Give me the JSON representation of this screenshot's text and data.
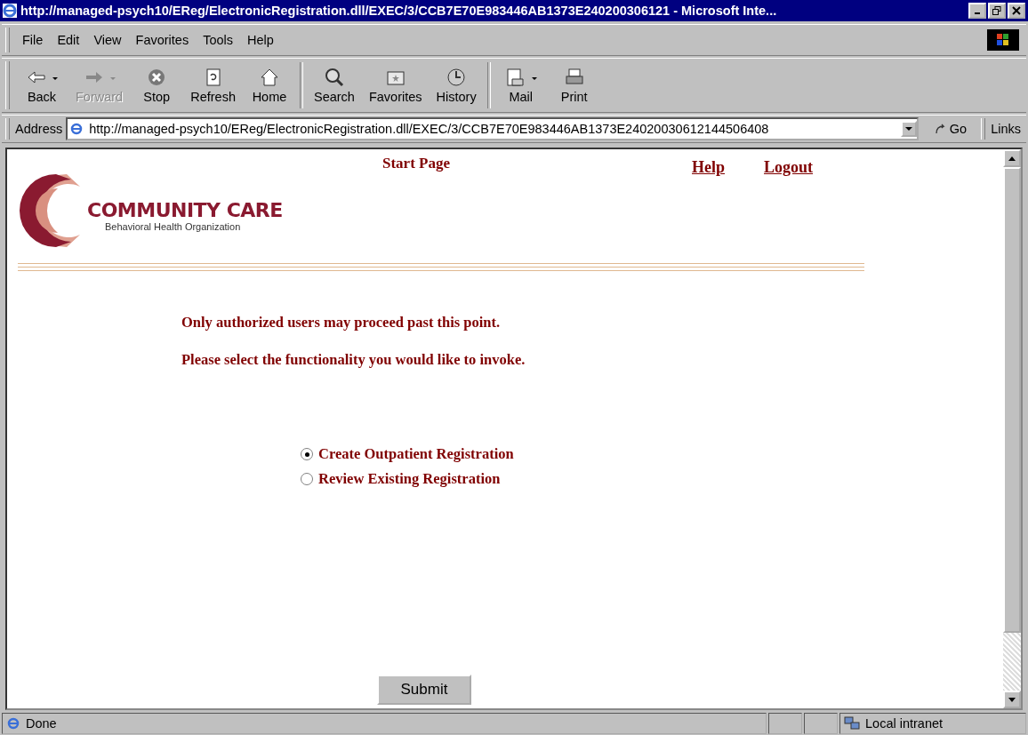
{
  "window": {
    "title": "http://managed-psych10/EReg/ElectronicRegistration.dll/EXEC/3/CCB7E70E983446AB1373E240200306121 - Microsoft Inte..."
  },
  "menu": [
    "File",
    "Edit",
    "View",
    "Favorites",
    "Tools",
    "Help"
  ],
  "toolbar": [
    {
      "label": "Back",
      "kind": "back",
      "disabled": false,
      "dropdown": true
    },
    {
      "label": "Forward",
      "kind": "forward",
      "disabled": true,
      "dropdown": true
    },
    {
      "label": "Stop",
      "kind": "stop",
      "disabled": false,
      "dropdown": false
    },
    {
      "label": "Refresh",
      "kind": "refresh",
      "disabled": false,
      "dropdown": false
    },
    {
      "label": "Home",
      "kind": "home",
      "disabled": false,
      "dropdown": false
    },
    {
      "label": "Search",
      "kind": "search",
      "disabled": false,
      "dropdown": false
    },
    {
      "label": "Favorites",
      "kind": "favorites",
      "disabled": false,
      "dropdown": false
    },
    {
      "label": "History",
      "kind": "history",
      "disabled": false,
      "dropdown": false
    },
    {
      "label": "Mail",
      "kind": "mail",
      "disabled": false,
      "dropdown": true
    },
    {
      "label": "Print",
      "kind": "print",
      "disabled": false,
      "dropdown": false
    }
  ],
  "address": {
    "label": "Address",
    "value": "http://managed-psych10/EReg/ElectronicRegistration.dll/EXEC/3/CCB7E70E983446AB1373E24020030612144506408",
    "go": "Go",
    "links": "Links"
  },
  "page": {
    "logo": {
      "name": "COMMUNITY CARE",
      "tagline": "Behavioral Health Organization"
    },
    "heading": "Start Page",
    "links": [
      "Help",
      "Logout"
    ],
    "messages": [
      "Only authorized users may proceed past this point.",
      "Please select the functionality you would like to invoke."
    ],
    "options": [
      {
        "label": "Create Outpatient Registration",
        "selected": true
      },
      {
        "label": "Review Existing Registration",
        "selected": false
      }
    ],
    "submit": "Submit"
  },
  "status_bar": {
    "text": "Done",
    "zone": "Local intranet"
  }
}
